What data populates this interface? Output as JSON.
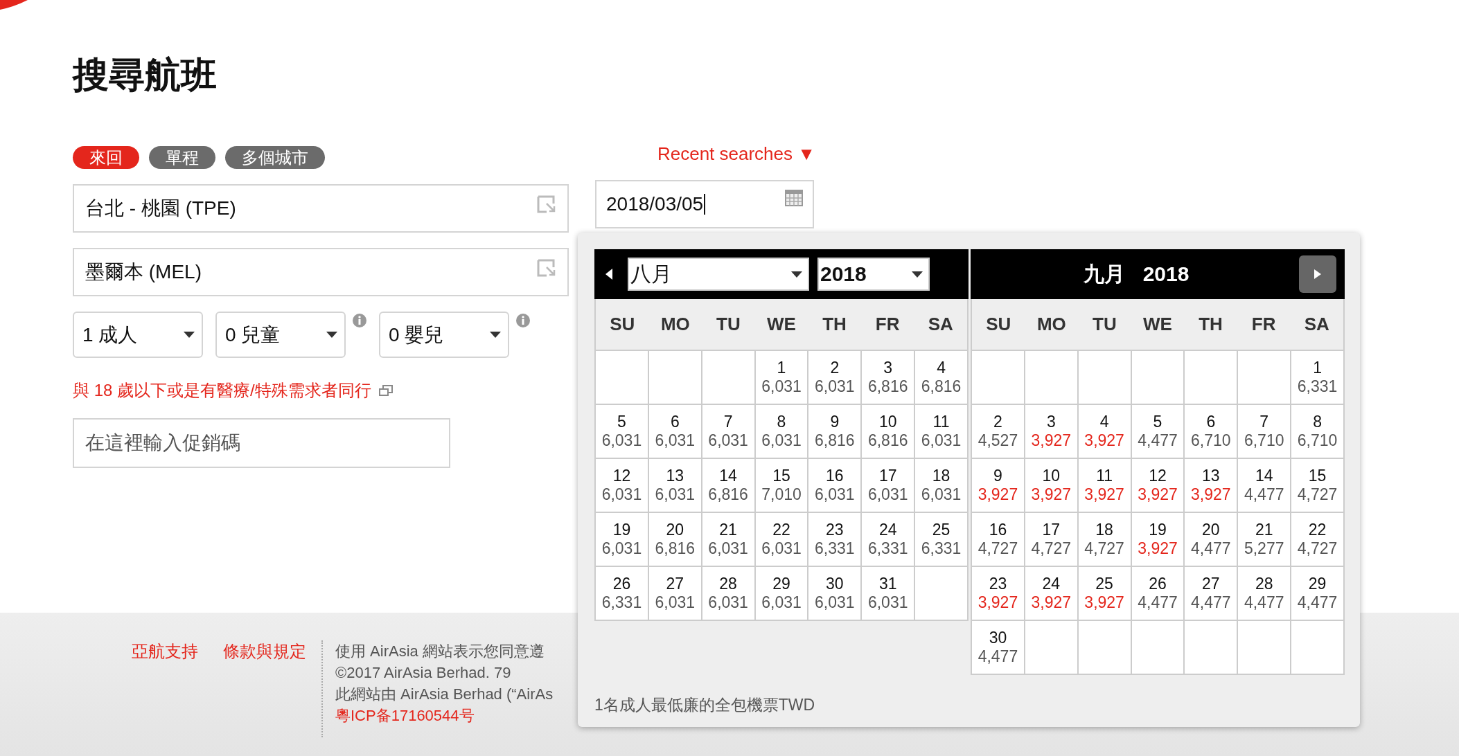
{
  "title": "搜尋航班",
  "trip_tabs": [
    {
      "label": "來回",
      "selected": true
    },
    {
      "label": "單程",
      "selected": false
    },
    {
      "label": "多個城市",
      "selected": false
    }
  ],
  "recent_searches": {
    "label": "Recent searches",
    "caret": "▼"
  },
  "origin": {
    "value": "台北 - 桃園 (TPE)"
  },
  "destination": {
    "value": "墨爾本 (MEL)"
  },
  "departure_date": {
    "value": "2018/03/05"
  },
  "passengers": [
    {
      "value": "1 成人",
      "info": false
    },
    {
      "value": "0 兒童",
      "info": true
    },
    {
      "value": "0 嬰兒",
      "info": true
    }
  ],
  "guardian_link": "與 18 歲以下或是有醫療/特殊需求者同行",
  "promo_code": {
    "placeholder": "在這裡輸入促銷碼"
  },
  "calendar": {
    "months": [
      {
        "kind": "select",
        "month": "八月",
        "year": "2018",
        "weekdays": [
          "SU",
          "MO",
          "TU",
          "WE",
          "TH",
          "FR",
          "SA"
        ],
        "weeks": [
          [
            {
              "kind": "blank"
            },
            {
              "kind": "blank"
            },
            {
              "kind": "blank"
            },
            {
              "day": "1",
              "price": "6,031",
              "lowest": false
            },
            {
              "day": "2",
              "price": "6,031",
              "lowest": false
            },
            {
              "day": "3",
              "price": "6,816",
              "lowest": false
            },
            {
              "day": "4",
              "price": "6,816",
              "lowest": false
            }
          ],
          [
            {
              "day": "5",
              "price": "6,031",
              "lowest": false
            },
            {
              "day": "6",
              "price": "6,031",
              "lowest": false
            },
            {
              "day": "7",
              "price": "6,031",
              "lowest": false
            },
            {
              "day": "8",
              "price": "6,031",
              "lowest": false
            },
            {
              "day": "9",
              "price": "6,816",
              "lowest": false
            },
            {
              "day": "10",
              "price": "6,816",
              "lowest": false
            },
            {
              "day": "11",
              "price": "6,031",
              "lowest": false
            }
          ],
          [
            {
              "day": "12",
              "price": "6,031",
              "lowest": false
            },
            {
              "day": "13",
              "price": "6,031",
              "lowest": false
            },
            {
              "day": "14",
              "price": "6,816",
              "lowest": false
            },
            {
              "day": "15",
              "price": "7,010",
              "lowest": false
            },
            {
              "day": "16",
              "price": "6,031",
              "lowest": false
            },
            {
              "day": "17",
              "price": "6,031",
              "lowest": false
            },
            {
              "day": "18",
              "price": "6,031",
              "lowest": false
            }
          ],
          [
            {
              "day": "19",
              "price": "6,031",
              "lowest": false
            },
            {
              "day": "20",
              "price": "6,816",
              "lowest": false
            },
            {
              "day": "21",
              "price": "6,031",
              "lowest": false
            },
            {
              "day": "22",
              "price": "6,031",
              "lowest": false
            },
            {
              "day": "23",
              "price": "6,331",
              "lowest": false
            },
            {
              "day": "24",
              "price": "6,331",
              "lowest": false
            },
            {
              "day": "25",
              "price": "6,331",
              "lowest": false
            }
          ],
          [
            {
              "day": "26",
              "price": "6,331",
              "lowest": false
            },
            {
              "day": "27",
              "price": "6,031",
              "lowest": false
            },
            {
              "day": "28",
              "price": "6,031",
              "lowest": false
            },
            {
              "day": "29",
              "price": "6,031",
              "lowest": false
            },
            {
              "day": "30",
              "price": "6,031",
              "lowest": false
            },
            {
              "day": "31",
              "price": "6,031",
              "lowest": false
            },
            {
              "kind": "blank"
            }
          ]
        ]
      },
      {
        "kind": "title",
        "month": "九月",
        "year": "2018",
        "weekdays": [
          "SU",
          "MO",
          "TU",
          "WE",
          "TH",
          "FR",
          "SA"
        ],
        "weeks": [
          [
            {
              "kind": "blank"
            },
            {
              "kind": "blank"
            },
            {
              "kind": "blank"
            },
            {
              "kind": "blank"
            },
            {
              "kind": "blank"
            },
            {
              "kind": "blank"
            },
            {
              "day": "1",
              "price": "6,331",
              "lowest": false
            }
          ],
          [
            {
              "day": "2",
              "price": "4,527",
              "lowest": false
            },
            {
              "day": "3",
              "price": "3,927",
              "lowest": true
            },
            {
              "day": "4",
              "price": "3,927",
              "lowest": true
            },
            {
              "day": "5",
              "price": "4,477",
              "lowest": false
            },
            {
              "day": "6",
              "price": "6,710",
              "lowest": false
            },
            {
              "day": "7",
              "price": "6,710",
              "lowest": false
            },
            {
              "day": "8",
              "price": "6,710",
              "lowest": false
            }
          ],
          [
            {
              "day": "9",
              "price": "3,927",
              "lowest": true
            },
            {
              "day": "10",
              "price": "3,927",
              "lowest": true
            },
            {
              "day": "11",
              "price": "3,927",
              "lowest": true
            },
            {
              "day": "12",
              "price": "3,927",
              "lowest": true
            },
            {
              "day": "13",
              "price": "3,927",
              "lowest": true
            },
            {
              "day": "14",
              "price": "4,477",
              "lowest": false
            },
            {
              "day": "15",
              "price": "4,727",
              "lowest": false
            }
          ],
          [
            {
              "day": "16",
              "price": "4,727",
              "lowest": false
            },
            {
              "day": "17",
              "price": "4,727",
              "lowest": false
            },
            {
              "day": "18",
              "price": "4,727",
              "lowest": false
            },
            {
              "day": "19",
              "price": "3,927",
              "lowest": true
            },
            {
              "day": "20",
              "price": "4,477",
              "lowest": false
            },
            {
              "day": "21",
              "price": "5,277",
              "lowest": false
            },
            {
              "day": "22",
              "price": "4,727",
              "lowest": false
            }
          ],
          [
            {
              "day": "23",
              "price": "3,927",
              "lowest": true
            },
            {
              "day": "24",
              "price": "3,927",
              "lowest": true
            },
            {
              "day": "25",
              "price": "3,927",
              "lowest": true
            },
            {
              "day": "26",
              "price": "4,477",
              "lowest": false
            },
            {
              "day": "27",
              "price": "4,477",
              "lowest": false
            },
            {
              "day": "28",
              "price": "4,477",
              "lowest": false
            },
            {
              "day": "29",
              "price": "4,477",
              "lowest": false
            }
          ],
          [
            {
              "day": "30",
              "price": "4,477",
              "lowest": false
            },
            {
              "kind": "blank"
            },
            {
              "kind": "blank"
            },
            {
              "kind": "blank"
            },
            {
              "kind": "blank"
            },
            {
              "kind": "blank"
            },
            {
              "kind": "blank"
            }
          ]
        ]
      }
    ],
    "note": "1名成人最低廉的全包機票TWD"
  },
  "footer": {
    "links": [
      "亞航支持",
      "條款與規定"
    ],
    "lines": [
      "使用 AirAsia 網站表示您同意遵",
      "©2017 AirAsia Berhad. 79",
      "此網站由 AirAsia Berhad (“AirAs"
    ],
    "icp": "粵ICP备17160544号"
  }
}
